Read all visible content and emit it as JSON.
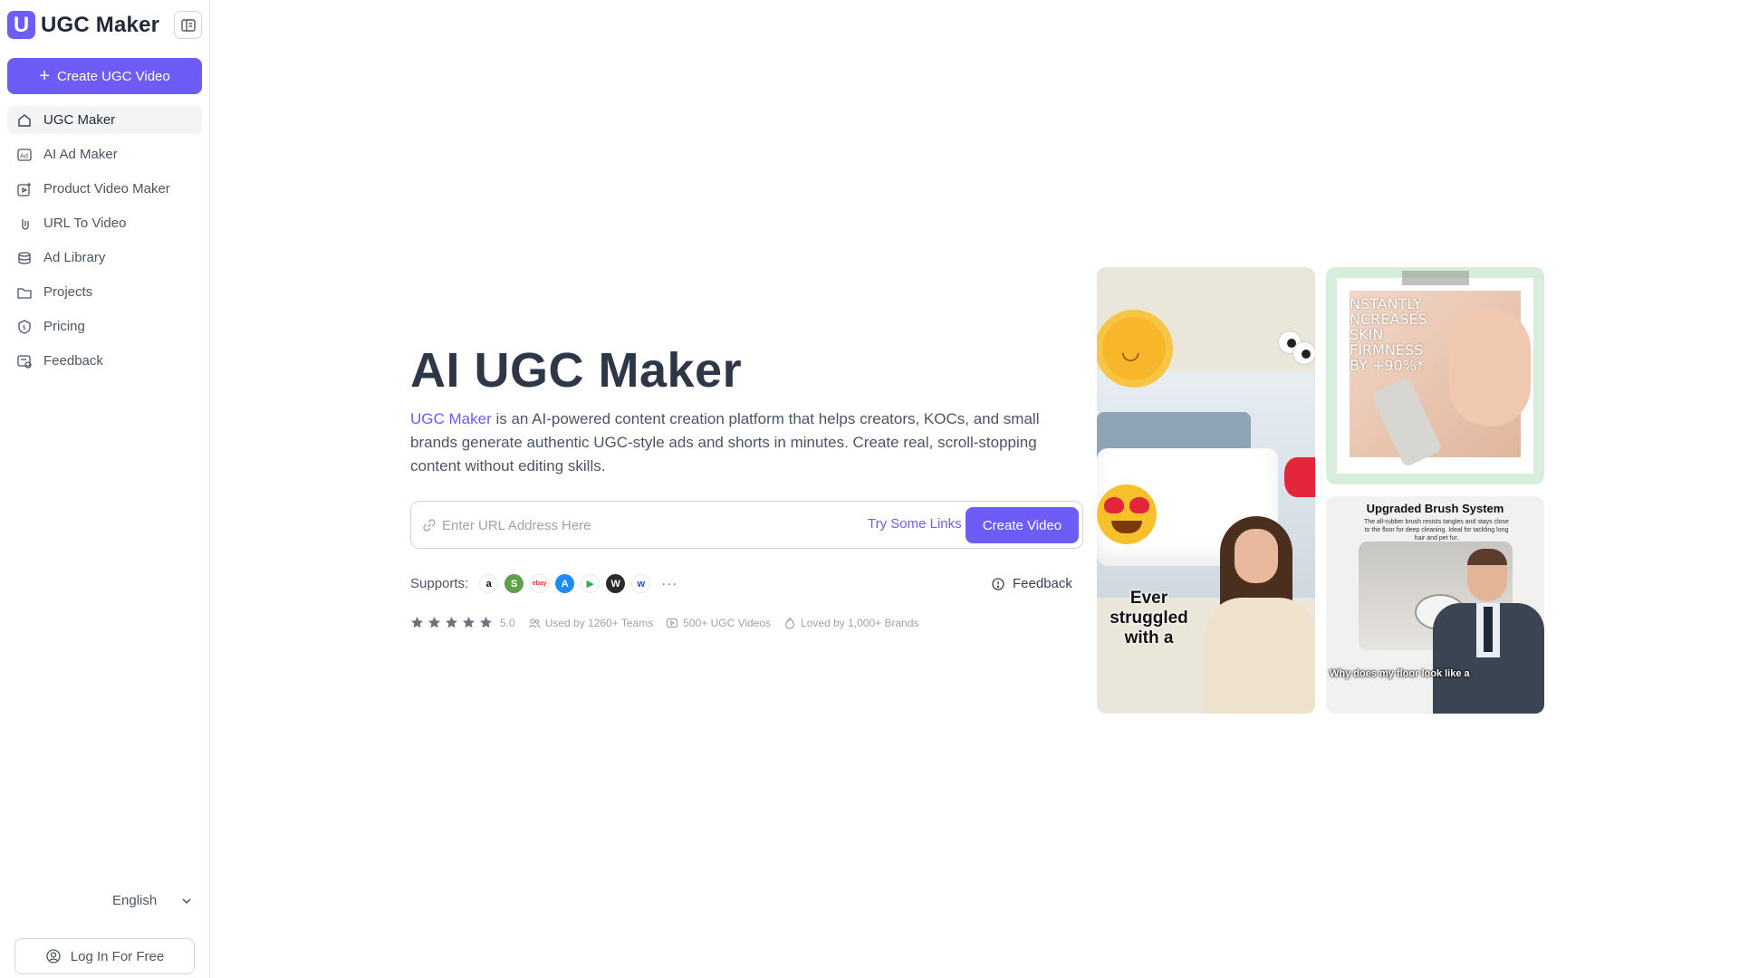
{
  "sidebar": {
    "brand_letter": "U",
    "brand_name": "UGC Maker",
    "create_button": "Create UGC Video",
    "items": [
      {
        "label": "UGC Maker",
        "icon": "home-icon",
        "active": true
      },
      {
        "label": "AI Ad Maker",
        "icon": "ad-icon"
      },
      {
        "label": "Product Video Maker",
        "icon": "product-video-icon"
      },
      {
        "label": "URL To Video",
        "icon": "link-icon"
      },
      {
        "label": "Ad Library",
        "icon": "library-icon"
      },
      {
        "label": "Projects",
        "icon": "folder-icon"
      },
      {
        "label": "Pricing",
        "icon": "pricing-icon"
      },
      {
        "label": "Feedback",
        "icon": "feedback-icon"
      }
    ],
    "language": "English",
    "login_button": "Log In For Free"
  },
  "hero": {
    "title": "AI UGC Maker",
    "description_link": "UGC Maker",
    "description_rest": " is an AI-powered content creation platform that helps creators, KOCs, and small brands generate authentic UGC-style ads and shorts in minutes. Create real, scroll-stopping content without editing skills.",
    "url_placeholder": "Enter URL Address Here",
    "try_links": "Try Some Links",
    "create_video": "Create Video",
    "supports_label": "Supports:",
    "supports": [
      {
        "name": "amazon",
        "glyph": "a",
        "color": "#ffffff",
        "fg": "#111111"
      },
      {
        "name": "shopify",
        "glyph": "S",
        "color": "#5fa04e",
        "fg": "#ffffff"
      },
      {
        "name": "ebay",
        "glyph": "ebay",
        "color": "#ffffff",
        "fg": "#e53238"
      },
      {
        "name": "app-store",
        "glyph": "A",
        "color": "#1d8cf8",
        "fg": "#ffffff"
      },
      {
        "name": "google-play",
        "glyph": "▶",
        "color": "#ffffff",
        "fg": "#34a853"
      },
      {
        "name": "wordpress",
        "glyph": "W",
        "color": "#2b2b2b",
        "fg": "#ffffff"
      },
      {
        "name": "walmart",
        "glyph": "w",
        "color": "#ffffff",
        "fg": "#1d4ed8"
      }
    ],
    "more": "···",
    "feedback": "Feedback",
    "rating": "5.0",
    "stars": 5,
    "used_by": "Used by 1260+ Teams",
    "videos": "500+ UGC Videos",
    "loved_by": "Loved by 1,000+ Brands"
  },
  "gallery": {
    "card1_caption": "Ever struggled with a",
    "card2_caption": "NSTANTLY\nNCREASES\nSKIN\nFIRMNESS\nBY +90%*",
    "card3_title": "Upgraded Brush System",
    "card3_sub": "The all-rubber brush resists tangles and stays close to the floor for deep cleaning. Ideal for tackling long hair and pet fur.",
    "card3_caption": "Why does my floor look like a"
  },
  "colors": {
    "accent": "#6d5df6",
    "text_dark": "#2d3748",
    "border": "#e5e7eb"
  }
}
